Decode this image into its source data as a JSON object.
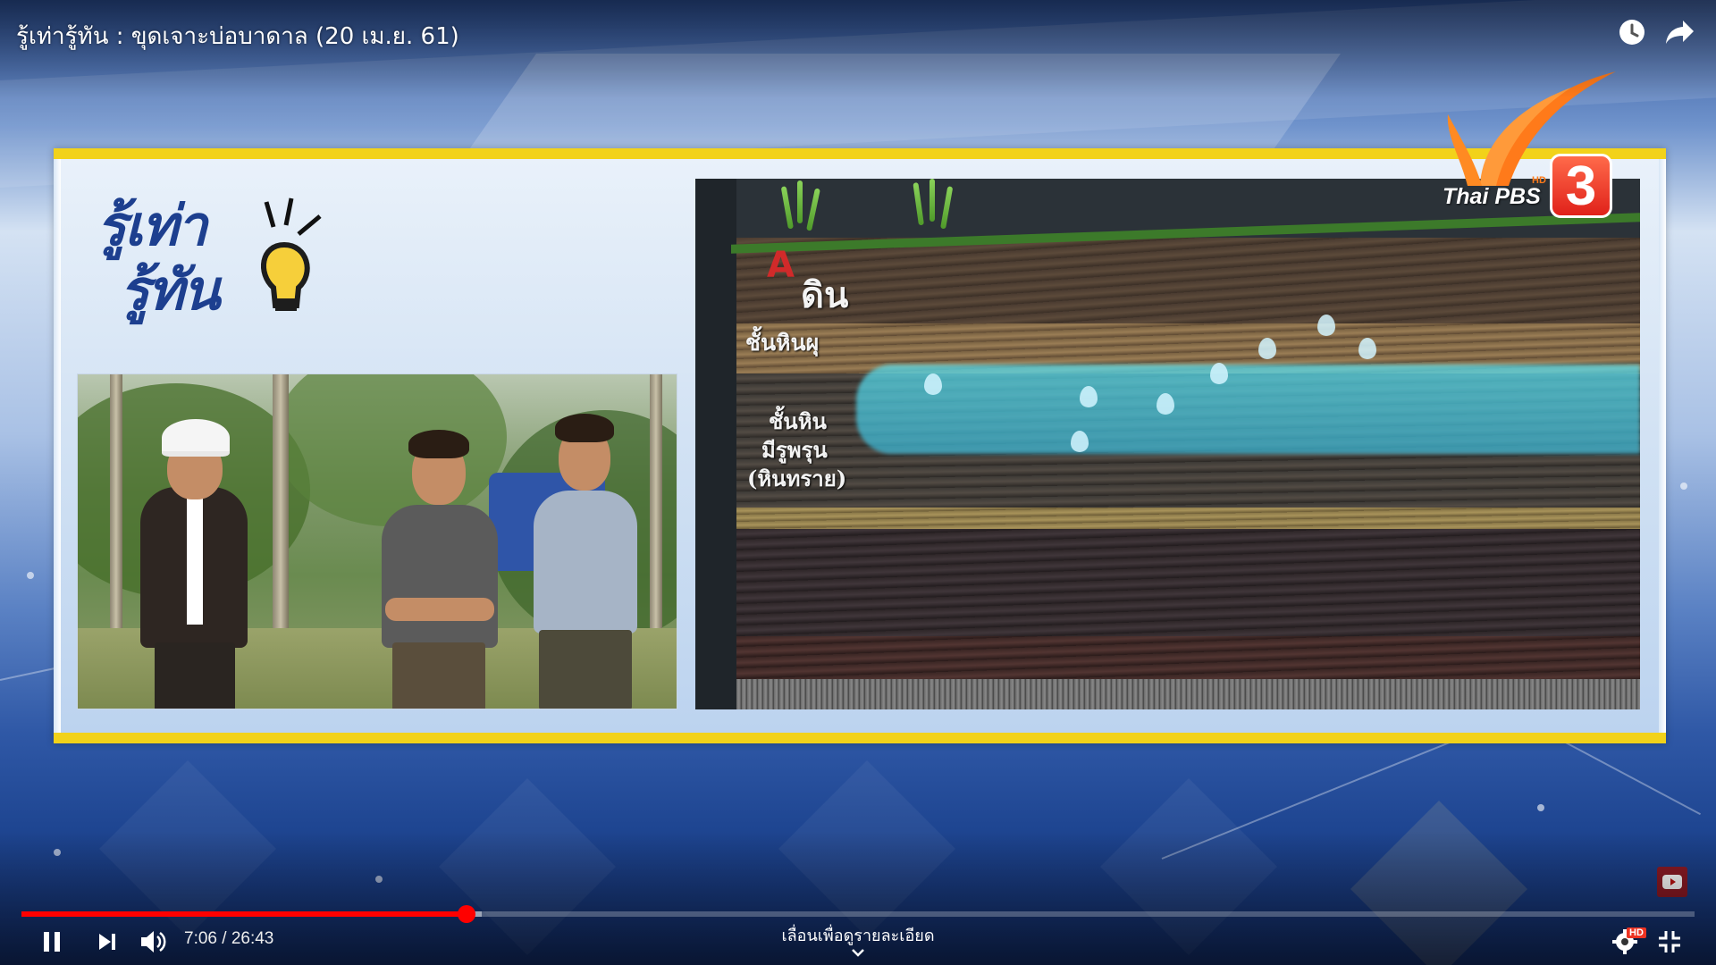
{
  "video": {
    "title": "รู้เท่ารู้ทัน : ขุดเจาะบ่อบาดาล (20 เม.ย. 61)",
    "current_time": "7:06",
    "time_separator": "/",
    "duration": "26:43",
    "played_fraction": 0.266,
    "buffered_fraction": 0.275
  },
  "top_actions": {
    "watch_later_icon": "clock-icon",
    "share_icon": "share-arrow-icon"
  },
  "show_logo": {
    "line1": "รู้เท่า",
    "line2": "รู้ทัน"
  },
  "channel_logo": {
    "name": "Thai PBS",
    "hd": "HD",
    "number": "3"
  },
  "diagram": {
    "marker": "A",
    "labels": {
      "soil": "ดิน",
      "weathered_rock": "ชั้นหินผุ",
      "porous_rock_line1": "ชั้นหิน",
      "porous_rock_line2": "มีรูพรุน",
      "porous_rock_line3": "(หินทราย)"
    }
  },
  "controls": {
    "play_pause_icon": "pause-icon",
    "next_icon": "next-icon",
    "volume_icon": "volume-icon",
    "settings_icon": "gear-icon",
    "settings_badge": "HD",
    "fullscreen_icon": "exit-fullscreen-icon",
    "scroll_hint": "เลื่อนเพื่อดูรายละเอียด"
  },
  "colors": {
    "progress": "#ff0000",
    "frame_border": "#f2d21a",
    "show_logo": "#1d3f8f"
  }
}
